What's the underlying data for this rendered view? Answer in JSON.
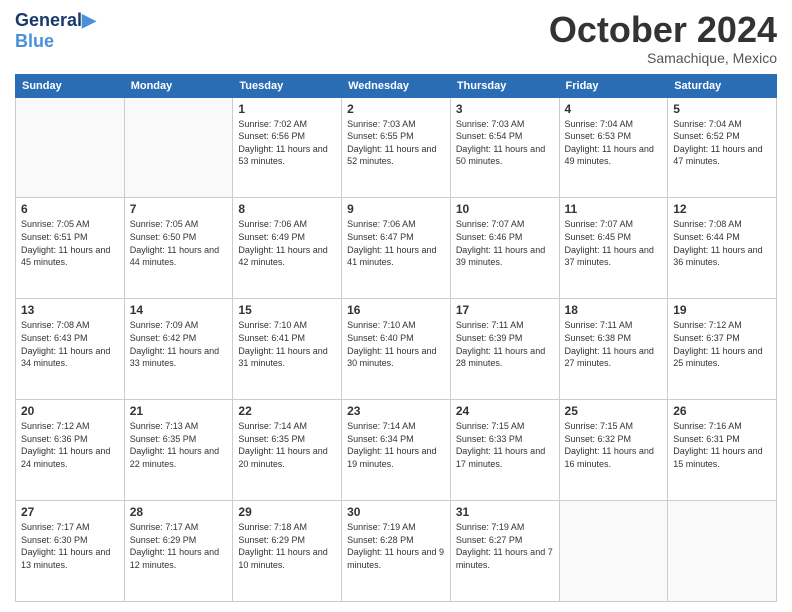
{
  "header": {
    "logo_line1": "General",
    "logo_line2": "Blue",
    "month_title": "October 2024",
    "location": "Samachique, Mexico"
  },
  "weekdays": [
    "Sunday",
    "Monday",
    "Tuesday",
    "Wednesday",
    "Thursday",
    "Friday",
    "Saturday"
  ],
  "weeks": [
    [
      {
        "day": "",
        "sunrise": "",
        "sunset": "",
        "daylight": ""
      },
      {
        "day": "",
        "sunrise": "",
        "sunset": "",
        "daylight": ""
      },
      {
        "day": "1",
        "sunrise": "Sunrise: 7:02 AM",
        "sunset": "Sunset: 6:56 PM",
        "daylight": "Daylight: 11 hours and 53 minutes."
      },
      {
        "day": "2",
        "sunrise": "Sunrise: 7:03 AM",
        "sunset": "Sunset: 6:55 PM",
        "daylight": "Daylight: 11 hours and 52 minutes."
      },
      {
        "day": "3",
        "sunrise": "Sunrise: 7:03 AM",
        "sunset": "Sunset: 6:54 PM",
        "daylight": "Daylight: 11 hours and 50 minutes."
      },
      {
        "day": "4",
        "sunrise": "Sunrise: 7:04 AM",
        "sunset": "Sunset: 6:53 PM",
        "daylight": "Daylight: 11 hours and 49 minutes."
      },
      {
        "day": "5",
        "sunrise": "Sunrise: 7:04 AM",
        "sunset": "Sunset: 6:52 PM",
        "daylight": "Daylight: 11 hours and 47 minutes."
      }
    ],
    [
      {
        "day": "6",
        "sunrise": "Sunrise: 7:05 AM",
        "sunset": "Sunset: 6:51 PM",
        "daylight": "Daylight: 11 hours and 45 minutes."
      },
      {
        "day": "7",
        "sunrise": "Sunrise: 7:05 AM",
        "sunset": "Sunset: 6:50 PM",
        "daylight": "Daylight: 11 hours and 44 minutes."
      },
      {
        "day": "8",
        "sunrise": "Sunrise: 7:06 AM",
        "sunset": "Sunset: 6:49 PM",
        "daylight": "Daylight: 11 hours and 42 minutes."
      },
      {
        "day": "9",
        "sunrise": "Sunrise: 7:06 AM",
        "sunset": "Sunset: 6:47 PM",
        "daylight": "Daylight: 11 hours and 41 minutes."
      },
      {
        "day": "10",
        "sunrise": "Sunrise: 7:07 AM",
        "sunset": "Sunset: 6:46 PM",
        "daylight": "Daylight: 11 hours and 39 minutes."
      },
      {
        "day": "11",
        "sunrise": "Sunrise: 7:07 AM",
        "sunset": "Sunset: 6:45 PM",
        "daylight": "Daylight: 11 hours and 37 minutes."
      },
      {
        "day": "12",
        "sunrise": "Sunrise: 7:08 AM",
        "sunset": "Sunset: 6:44 PM",
        "daylight": "Daylight: 11 hours and 36 minutes."
      }
    ],
    [
      {
        "day": "13",
        "sunrise": "Sunrise: 7:08 AM",
        "sunset": "Sunset: 6:43 PM",
        "daylight": "Daylight: 11 hours and 34 minutes."
      },
      {
        "day": "14",
        "sunrise": "Sunrise: 7:09 AM",
        "sunset": "Sunset: 6:42 PM",
        "daylight": "Daylight: 11 hours and 33 minutes."
      },
      {
        "day": "15",
        "sunrise": "Sunrise: 7:10 AM",
        "sunset": "Sunset: 6:41 PM",
        "daylight": "Daylight: 11 hours and 31 minutes."
      },
      {
        "day": "16",
        "sunrise": "Sunrise: 7:10 AM",
        "sunset": "Sunset: 6:40 PM",
        "daylight": "Daylight: 11 hours and 30 minutes."
      },
      {
        "day": "17",
        "sunrise": "Sunrise: 7:11 AM",
        "sunset": "Sunset: 6:39 PM",
        "daylight": "Daylight: 11 hours and 28 minutes."
      },
      {
        "day": "18",
        "sunrise": "Sunrise: 7:11 AM",
        "sunset": "Sunset: 6:38 PM",
        "daylight": "Daylight: 11 hours and 27 minutes."
      },
      {
        "day": "19",
        "sunrise": "Sunrise: 7:12 AM",
        "sunset": "Sunset: 6:37 PM",
        "daylight": "Daylight: 11 hours and 25 minutes."
      }
    ],
    [
      {
        "day": "20",
        "sunrise": "Sunrise: 7:12 AM",
        "sunset": "Sunset: 6:36 PM",
        "daylight": "Daylight: 11 hours and 24 minutes."
      },
      {
        "day": "21",
        "sunrise": "Sunrise: 7:13 AM",
        "sunset": "Sunset: 6:35 PM",
        "daylight": "Daylight: 11 hours and 22 minutes."
      },
      {
        "day": "22",
        "sunrise": "Sunrise: 7:14 AM",
        "sunset": "Sunset: 6:35 PM",
        "daylight": "Daylight: 11 hours and 20 minutes."
      },
      {
        "day": "23",
        "sunrise": "Sunrise: 7:14 AM",
        "sunset": "Sunset: 6:34 PM",
        "daylight": "Daylight: 11 hours and 19 minutes."
      },
      {
        "day": "24",
        "sunrise": "Sunrise: 7:15 AM",
        "sunset": "Sunset: 6:33 PM",
        "daylight": "Daylight: 11 hours and 17 minutes."
      },
      {
        "day": "25",
        "sunrise": "Sunrise: 7:15 AM",
        "sunset": "Sunset: 6:32 PM",
        "daylight": "Daylight: 11 hours and 16 minutes."
      },
      {
        "day": "26",
        "sunrise": "Sunrise: 7:16 AM",
        "sunset": "Sunset: 6:31 PM",
        "daylight": "Daylight: 11 hours and 15 minutes."
      }
    ],
    [
      {
        "day": "27",
        "sunrise": "Sunrise: 7:17 AM",
        "sunset": "Sunset: 6:30 PM",
        "daylight": "Daylight: 11 hours and 13 minutes."
      },
      {
        "day": "28",
        "sunrise": "Sunrise: 7:17 AM",
        "sunset": "Sunset: 6:29 PM",
        "daylight": "Daylight: 11 hours and 12 minutes."
      },
      {
        "day": "29",
        "sunrise": "Sunrise: 7:18 AM",
        "sunset": "Sunset: 6:29 PM",
        "daylight": "Daylight: 11 hours and 10 minutes."
      },
      {
        "day": "30",
        "sunrise": "Sunrise: 7:19 AM",
        "sunset": "Sunset: 6:28 PM",
        "daylight": "Daylight: 11 hours and 9 minutes."
      },
      {
        "day": "31",
        "sunrise": "Sunrise: 7:19 AM",
        "sunset": "Sunset: 6:27 PM",
        "daylight": "Daylight: 11 hours and 7 minutes."
      },
      {
        "day": "",
        "sunrise": "",
        "sunset": "",
        "daylight": ""
      },
      {
        "day": "",
        "sunrise": "",
        "sunset": "",
        "daylight": ""
      }
    ]
  ]
}
